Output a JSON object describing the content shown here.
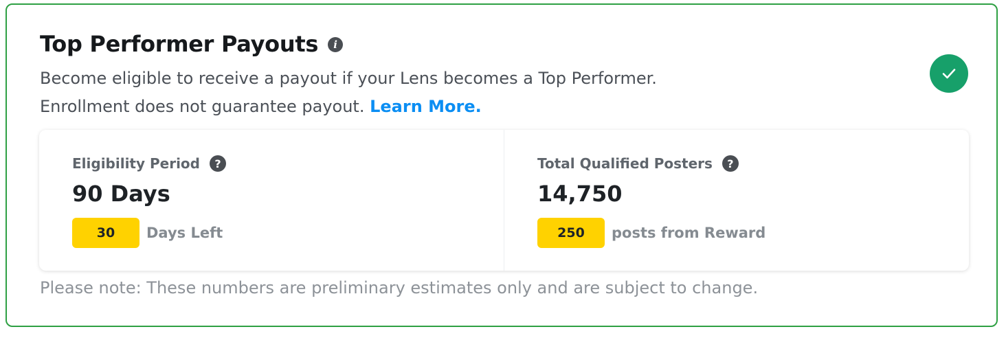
{
  "header": {
    "title": "Top Performer Payouts",
    "info_icon": "info-icon",
    "description_line1": "Become eligible to receive a payout if your Lens becomes a Top Performer.",
    "description_line2": "Enrollment does not guarantee payout.",
    "learn_more": "Learn More.",
    "status_icon": "check-icon",
    "accent_color": "#17a06a",
    "link_color": "#0b8ef3"
  },
  "stats": [
    {
      "label": "Eligibility Period",
      "value": "90 Days",
      "badge": "30",
      "sub_text": "Days Left",
      "help_icon": "question-icon"
    },
    {
      "label": "Total Qualified Posters",
      "value": "14,750",
      "badge": "250",
      "sub_text": "posts from Reward",
      "help_icon": "question-icon"
    }
  ],
  "note": "Please note: These numbers are preliminary estimates only and are subject to change.",
  "colors": {
    "border": "#2ea043",
    "badge": "#ffd200"
  }
}
